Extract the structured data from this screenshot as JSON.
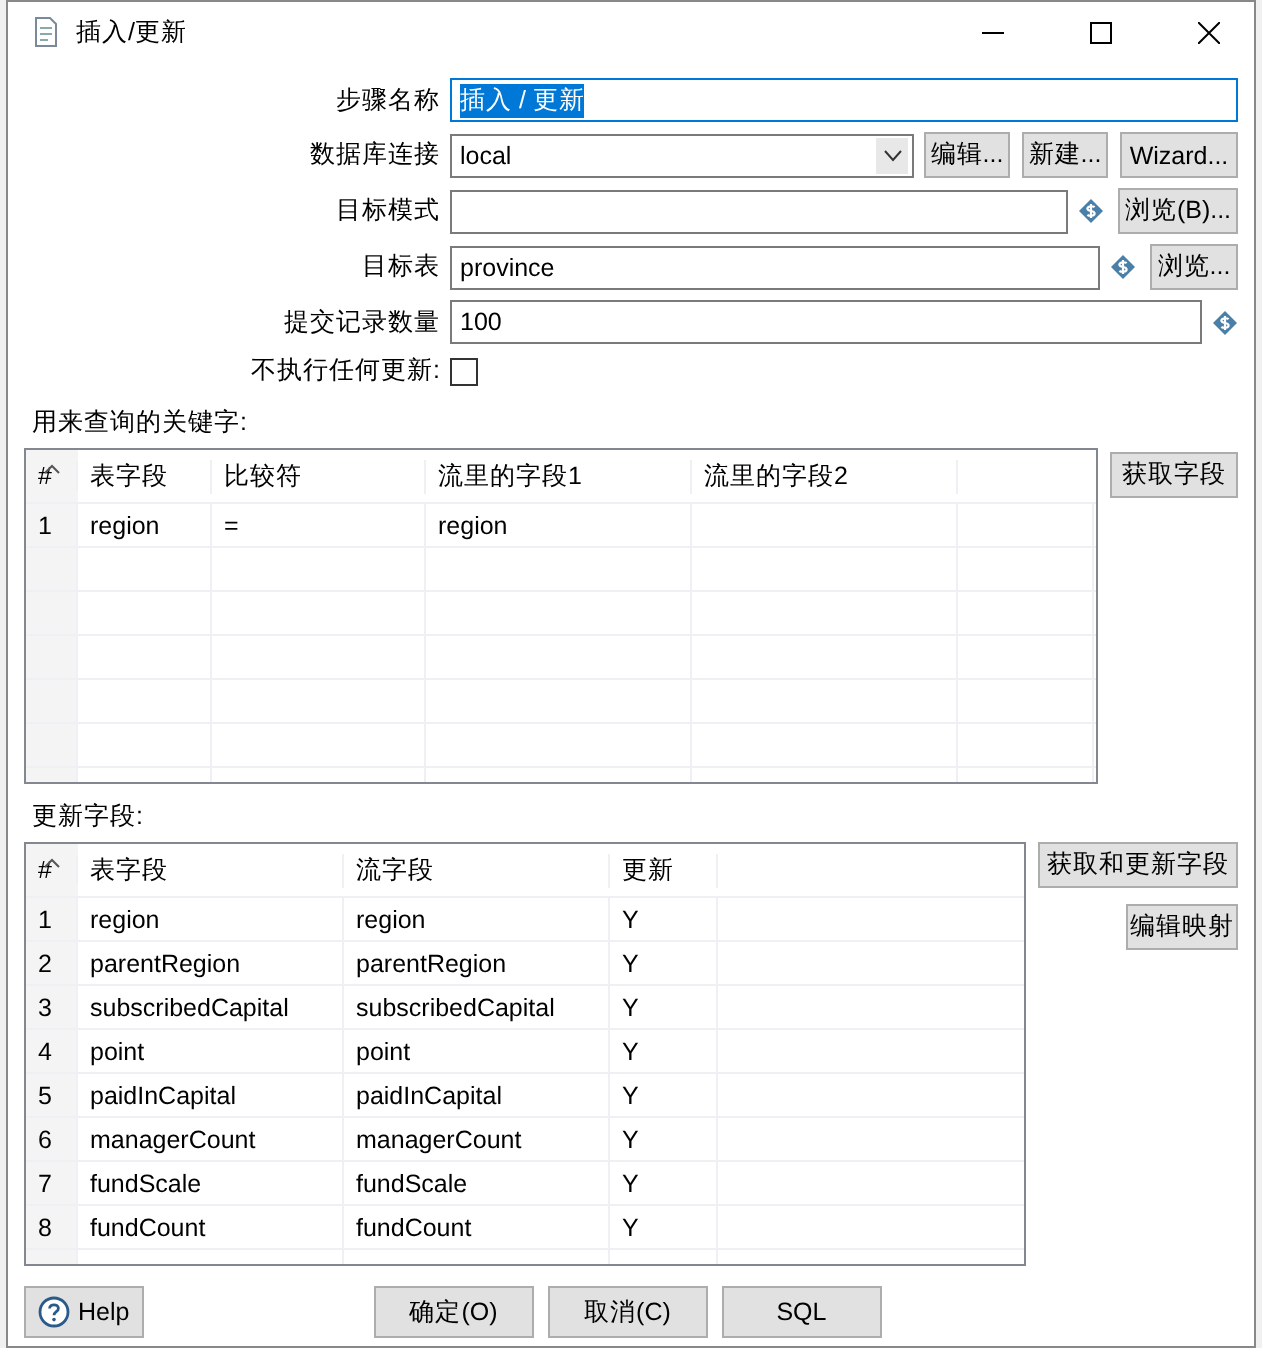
{
  "window": {
    "title": "插入/更新"
  },
  "form": {
    "step_name": {
      "label": "步骤名称",
      "value": "插入 / 更新",
      "selected": true
    },
    "connection": {
      "label": "数据库连接",
      "value": "local",
      "buttons": [
        "编辑...",
        "新建...",
        "Wizard..."
      ]
    },
    "target_schema": {
      "label": "目标模式",
      "button": "浏览(B)..."
    },
    "target_table": {
      "label": "目标表",
      "value": "province",
      "button": "浏览..."
    },
    "commit_size": {
      "label": "提交记录数量",
      "value": "100"
    },
    "no_update": {
      "label": "不执行任何更新:",
      "checked": false
    }
  },
  "key_table": {
    "label": "用来查询的关键字:",
    "button": "获取字段",
    "columns": [
      "#",
      "表字段",
      "比较符",
      "流里的字段1",
      "流里的字段2"
    ],
    "rows": [
      [
        "1",
        "region",
        "=",
        "region",
        ""
      ]
    ]
  },
  "update_table": {
    "label": "更新字段:",
    "buttons": [
      "获取和更新字段",
      "编辑映射"
    ],
    "columns": [
      "#",
      "表字段",
      "流字段",
      "更新"
    ],
    "rows": [
      [
        "1",
        "region",
        "region",
        "Y"
      ],
      [
        "2",
        "parentRegion",
        "parentRegion",
        "Y"
      ],
      [
        "3",
        "subscribedCapital",
        "subscribedCapital",
        "Y"
      ],
      [
        "4",
        "point",
        "point",
        "Y"
      ],
      [
        "5",
        "paidInCapital",
        "paidInCapital",
        "Y"
      ],
      [
        "6",
        "managerCount",
        "managerCount",
        "Y"
      ],
      [
        "7",
        "fundScale",
        "fundScale",
        "Y"
      ],
      [
        "8",
        "fundCount",
        "fundCount",
        "Y"
      ]
    ]
  },
  "footer": {
    "help": "Help",
    "buttons": [
      "确定(O)",
      "取消(C)",
      "SQL"
    ]
  }
}
